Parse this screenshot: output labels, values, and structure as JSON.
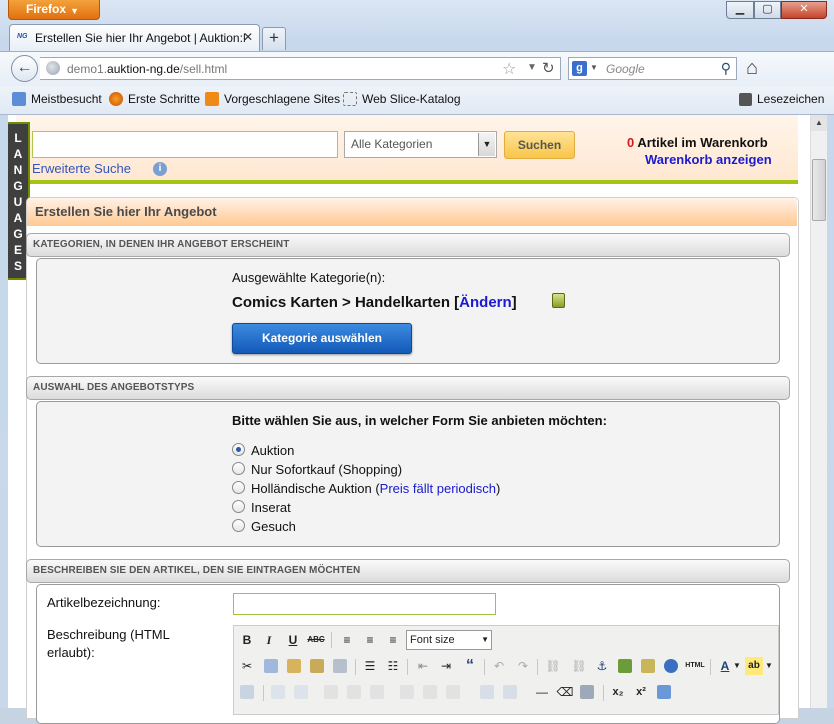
{
  "browser": {
    "menu_button": "Firefox",
    "window_controls": {
      "minimize": "▁",
      "maximize": "▢",
      "close": "✕"
    },
    "tab_title": "Erstellen Sie hier Ihr Angebot | Auktion:N...",
    "tab_favicon": "NG",
    "url_prefix": "demo1.",
    "url_domain": "auktion-ng.de",
    "url_path": "/sell.html",
    "search_placeholder": "Google",
    "bookmarks": [
      "Meistbesucht",
      "Erste Schritte",
      "Vorgeschlagene Sites",
      "Web Slice-Katalog"
    ],
    "bookmarks_menu": "Lesezeichen"
  },
  "header": {
    "search_value": "",
    "category_select": "Alle Kategorien",
    "search_button": "Suchen",
    "advanced_search": "Erweiterte Suche",
    "cart_count": "0",
    "cart_label": " Artikel im Warenkorb",
    "cart_link": "Warenkorb anzeigen"
  },
  "languages_tab": [
    "L",
    "A",
    "N",
    "G",
    "U",
    "A",
    "G",
    "E",
    "S"
  ],
  "page": {
    "title": "Erstellen Sie hier Ihr Angebot",
    "section_categories": "KATEGORIEN, IN DENEN IHR ANGEBOT ERSCHEINT",
    "selected_categories_label": "Ausgewählte Kategorie(n):",
    "category_path": "Comics Karten > Handelkarten",
    "change_link": "Ändern",
    "choose_category_button": "Kategorie auswählen",
    "section_type": "AUSWAHL DES ANGEBOTSTYPS",
    "type_question": "Bitte wählen Sie aus, in welcher Form Sie anbieten möchten:",
    "type_options": [
      {
        "label": "Auktion",
        "hint": "",
        "selected": true
      },
      {
        "label": "Nur Sofortkauf (Shopping)",
        "hint": "",
        "selected": false
      },
      {
        "label": "Holländische Auktion",
        "hint": "Preis fällt periodisch",
        "selected": false
      },
      {
        "label": "Inserat",
        "hint": "",
        "selected": false
      },
      {
        "label": "Gesuch",
        "hint": "",
        "selected": false
      }
    ],
    "section_describe": "BESCHREIBEN SIE DEN ARTIKEL, DEN SIE EINTRAGEN MÖCHTEN",
    "item_name_label": "Artikelbezeichnung:",
    "item_name_value": "",
    "description_label": "Beschreibung (HTML erlaubt):",
    "editor_font_size": "Font size"
  },
  "colors": {
    "accent_green": "#a6c414",
    "cart_count_red": "#d21a1a",
    "link_blue": "#1a1ad0",
    "button_blue": "#1259b8",
    "search_button_yellow": "#f8c548"
  }
}
